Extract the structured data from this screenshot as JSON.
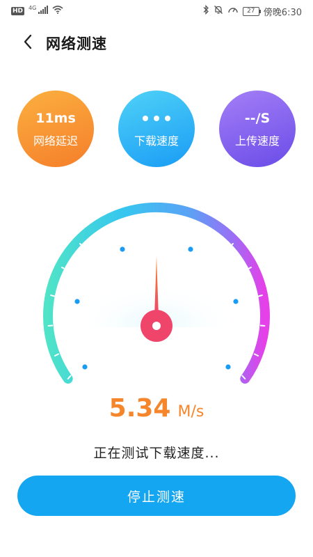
{
  "status_bar": {
    "hd": "HD",
    "network": "4G",
    "battery": "27",
    "time": "傍晚6:30"
  },
  "header": {
    "title": "网络测速",
    "back_icon": "chevron-left-icon"
  },
  "metrics": {
    "latency": {
      "value": "11ms",
      "label": "网络延迟"
    },
    "download": {
      "label": "下载速度"
    },
    "upload": {
      "value": "--/S",
      "label": "上传速度"
    }
  },
  "result": {
    "value": "5.34",
    "unit": "M/s",
    "status": "正在测试下载速度..."
  },
  "actions": {
    "stop_label": "停止测速"
  },
  "colors": {
    "accent": "#15a6f1",
    "speed_text": "#f5862b",
    "latency_grad": [
      "#fbb040",
      "#f57e2a"
    ],
    "download_grad": [
      "#4fd2f7",
      "#1a9cf5"
    ],
    "upload_grad": [
      "#a47ff6",
      "#6a4ce8"
    ],
    "needle_hub": "#f0456b"
  }
}
